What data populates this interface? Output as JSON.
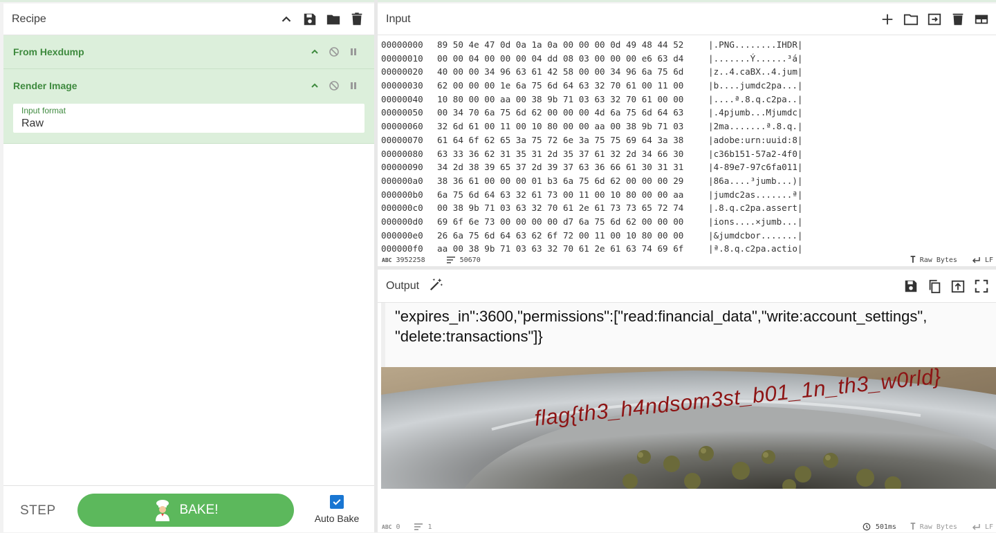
{
  "recipe": {
    "title": "Recipe",
    "icons": [
      "chevron-up-icon",
      "save-icon",
      "folder-icon",
      "trash-icon"
    ],
    "operations": [
      {
        "name": "From Hexdump"
      },
      {
        "name": "Render Image",
        "arg_label": "Input format",
        "arg_value": "Raw"
      }
    ],
    "step_label": "STEP",
    "bake_label": "BAKE!",
    "auto_bake_label": "Auto Bake",
    "auto_bake_checked": true
  },
  "input": {
    "title": "Input",
    "rows": [
      {
        "offset": "00000000",
        "bytes": "89 50 4e 47 0d 0a 1a 0a 00 00 00 0d 49 48 44 52",
        "ascii": "|.PNG........IHDR|"
      },
      {
        "offset": "00000010",
        "bytes": "00 00 04 00 00 00 04 dd 08 03 00 00 00 e6 63 d4",
        "ascii": "|.......Ý......³á|"
      },
      {
        "offset": "00000020",
        "bytes": "40 00 00 34 96 63 61 42 58 00 00 34 96 6a 75 6d",
        "ascii": "|z..4.caBX..4.jum|"
      },
      {
        "offset": "00000030",
        "bytes": "62 00 00 00 1e 6a 75 6d 64 63 32 70 61 00 11 00",
        "ascii": "|b....jumdc2pa...|"
      },
      {
        "offset": "00000040",
        "bytes": "10 80 00 00 aa 00 38 9b 71 03 63 32 70 61 00 00",
        "ascii": "|....ª.8.q.c2pa..|"
      },
      {
        "offset": "00000050",
        "bytes": "00 34 70 6a 75 6d 62 00 00 00 4d 6a 75 6d 64 63",
        "ascii": "|.4pjumb...Mjumdc|"
      },
      {
        "offset": "00000060",
        "bytes": "32 6d 61 00 11 00 10 80 00 00 aa 00 38 9b 71 03",
        "ascii": "|2ma.......ª.8.q.|"
      },
      {
        "offset": "00000070",
        "bytes": "61 64 6f 62 65 3a 75 72 6e 3a 75 75 69 64 3a 38",
        "ascii": "|adobe:urn:uuid:8|"
      },
      {
        "offset": "00000080",
        "bytes": "63 33 36 62 31 35 31 2d 35 37 61 32 2d 34 66 30",
        "ascii": "|c36b151-57a2-4f0|"
      },
      {
        "offset": "00000090",
        "bytes": "34 2d 38 39 65 37 2d 39 37 63 36 66 61 30 31 31",
        "ascii": "|4-89e7-97c6fa011|"
      },
      {
        "offset": "000000a0",
        "bytes": "38 36 61 00 00 00 01 b3 6a 75 6d 62 00 00 00 29",
        "ascii": "|86a....³jumb...)|"
      },
      {
        "offset": "000000b0",
        "bytes": "6a 75 6d 64 63 32 61 73 00 11 00 10 80 00 00 aa",
        "ascii": "|jumdc2as.......ª|"
      },
      {
        "offset": "000000c0",
        "bytes": "00 38 9b 71 03 63 32 70 61 2e 61 73 73 65 72 74",
        "ascii": "|.8.q.c2pa.assert|"
      },
      {
        "offset": "000000d0",
        "bytes": "69 6f 6e 73 00 00 00 00 d7 6a 75 6d 62 00 00 00",
        "ascii": "|ions....×jumb...|"
      },
      {
        "offset": "000000e0",
        "bytes": "26 6a 75 6d 64 63 62 6f 72 00 11 00 10 80 00 00",
        "ascii": "|&jumdcbor.......|"
      },
      {
        "offset": "000000f0",
        "bytes": "aa 00 38 9b 71 03 63 32 70 61 2e 61 63 74 69 6f",
        "ascii": "|ª.8.q.c2pa.actio|"
      }
    ],
    "status": {
      "length": "3952258",
      "lines": "50670",
      "encoding": "Raw Bytes",
      "eol": "LF"
    }
  },
  "output": {
    "title": "Output",
    "image_text_lines": [
      "\"expires_in\":3600,\"permissions\":[\"read:financial_data\",\"write:account_settings\",",
      "\"delete:transactions\"]}"
    ],
    "flag_text": "flag{th3_h4ndsom3st_b01_1n_th3_w0rld}",
    "status": {
      "length": "0",
      "lines": "1",
      "time": "501ms",
      "encoding": "Raw Bytes",
      "eol": "LF"
    }
  },
  "colors": {
    "operation_bg": "#dcefdb",
    "operation_text": "#3e8a3e",
    "bake_button": "#5cb85c",
    "checkbox": "#1976d2"
  }
}
